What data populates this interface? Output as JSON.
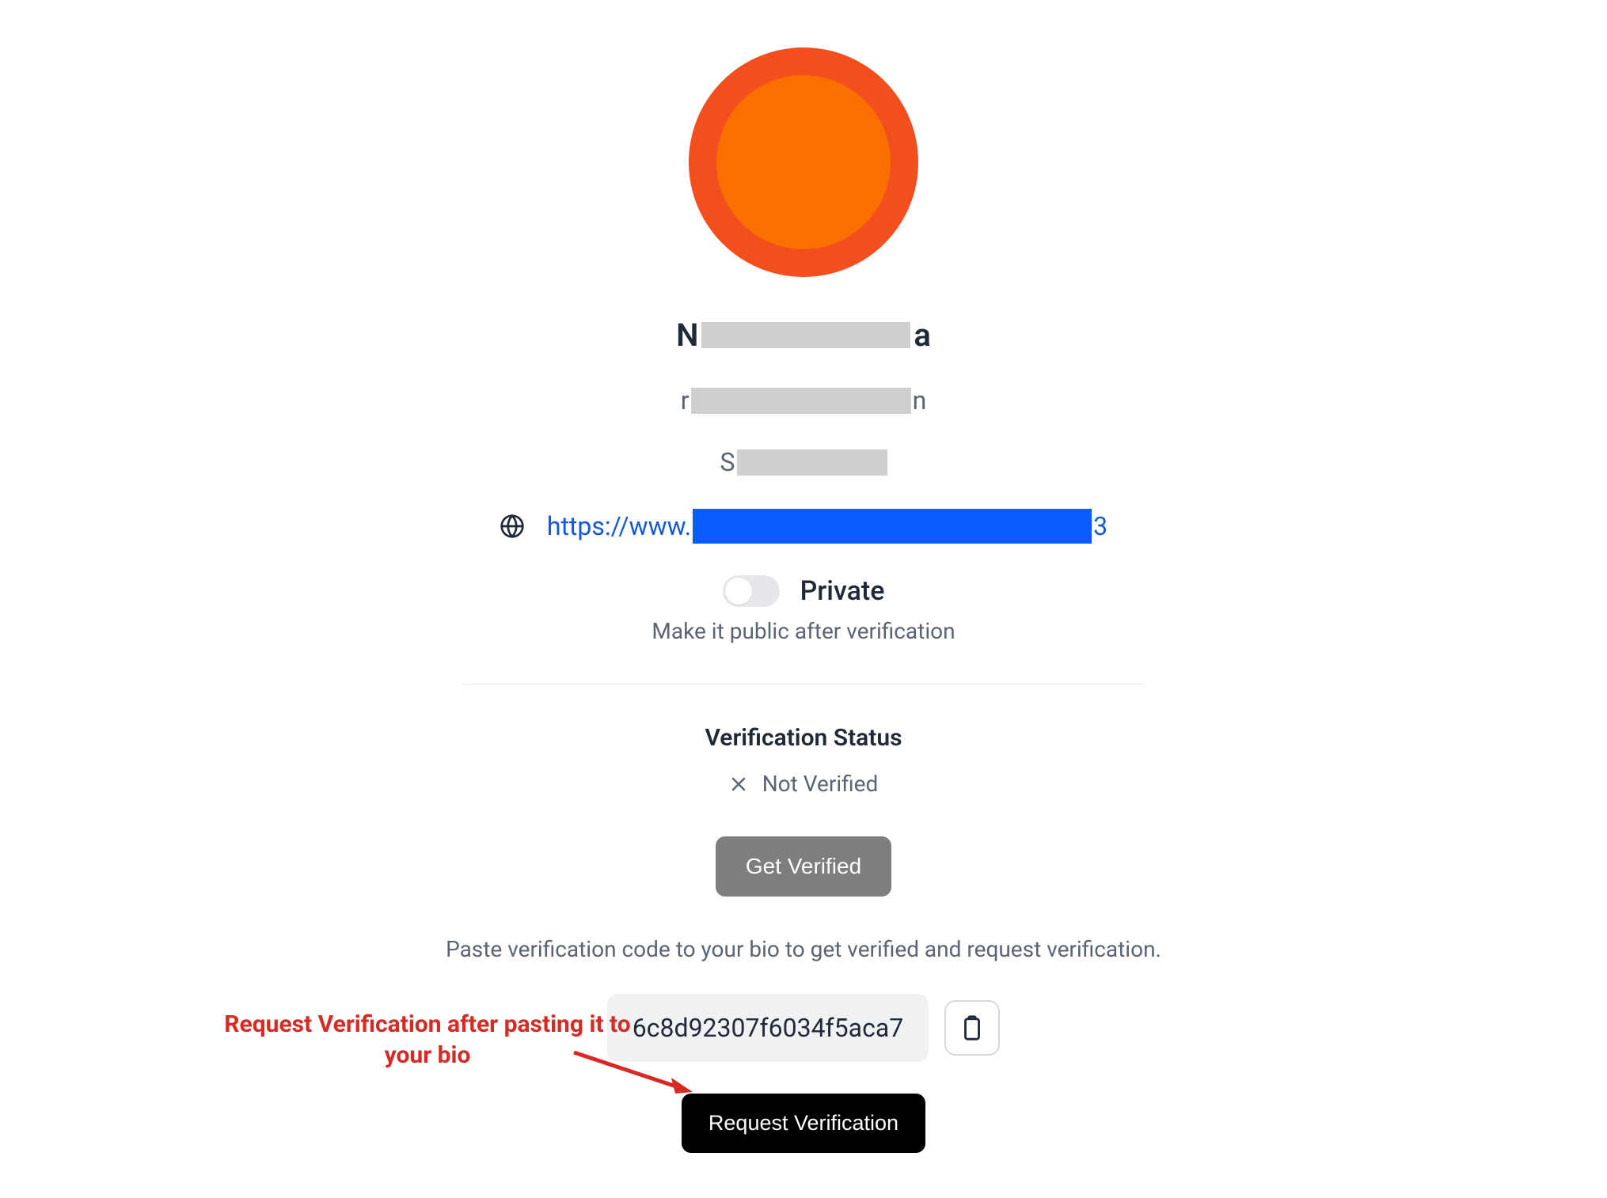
{
  "profile": {
    "name_prefix": "N",
    "name_suffix": "a",
    "email_prefix": "r",
    "email_suffix": "n",
    "type_prefix": "S",
    "link_prefix": "https://www.",
    "link_suffix": "3"
  },
  "privacy": {
    "label": "Private",
    "hint": "Make it public after verification"
  },
  "verification": {
    "section_title": "Verification Status",
    "status_text": "Not Verified",
    "get_verified_label": "Get Verified",
    "instruction": "Paste verification code to your bio to get verified and request verification.",
    "code": "6c8d92307f6034f5aca7",
    "request_label": "Request Verification"
  },
  "annotation": {
    "text": "Request Verification after pasting it to your bio"
  }
}
